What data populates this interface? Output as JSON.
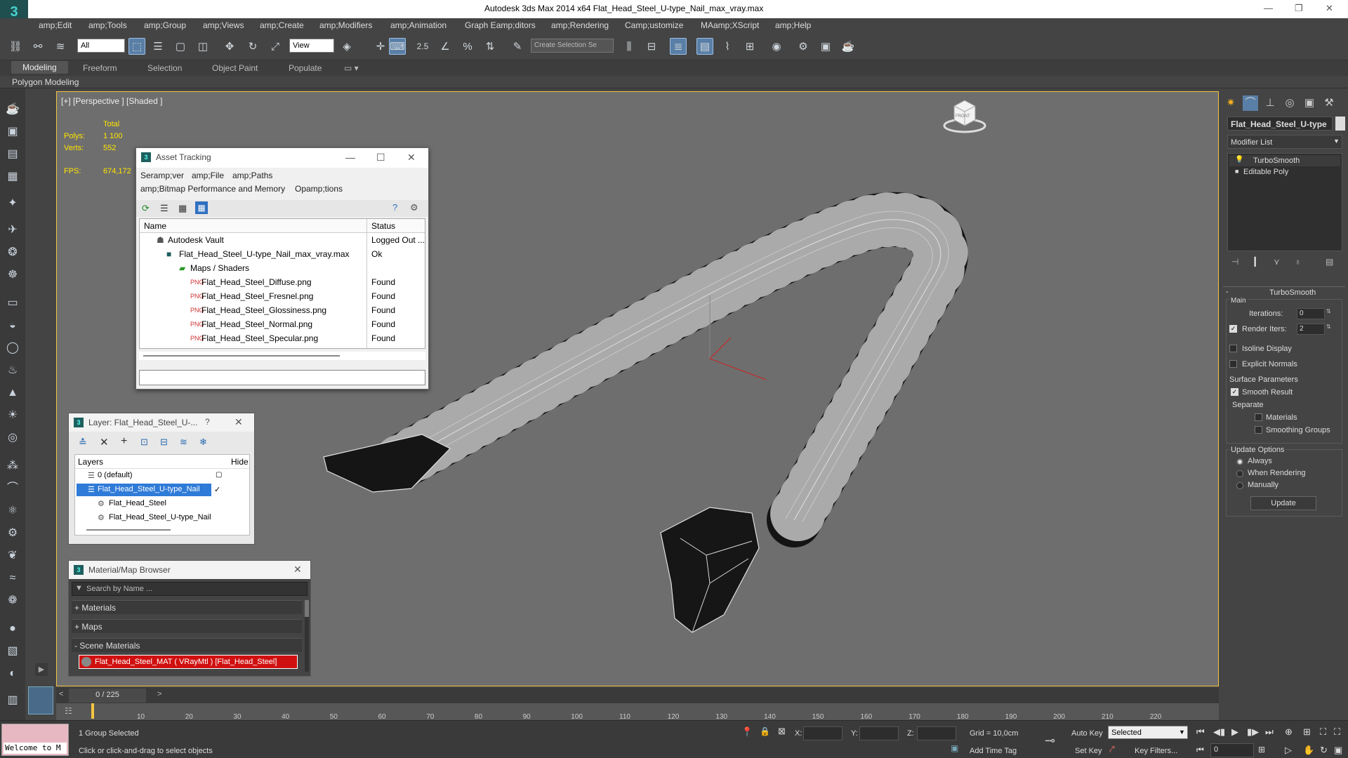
{
  "app": {
    "title": "Autodesk 3ds Max  2014 x64     Flat_Head_Steel_U-type_Nail_max_vray.max",
    "logo_letter": "3",
    "window_controls": [
      "—",
      "❐",
      "✕"
    ]
  },
  "menu": [
    "amp;Edit",
    "amp;Tools",
    "amp;Group",
    "amp;Views",
    "amp;Create",
    "amp;Modifiers",
    "amp;Animation",
    "Graph Eamp;ditors",
    "amp;Rendering",
    "Camp;ustomize",
    "MAamp;XScript",
    "amp;Help"
  ],
  "toolbar": {
    "filter_value": "All",
    "refcoord_value": "View",
    "snap_label": "2.5",
    "selection_set_placeholder": "Create Selection Se"
  },
  "ribbon": {
    "tabs": [
      "Modeling",
      "Freeform",
      "Selection",
      "Object Paint",
      "Populate"
    ],
    "active": "Modeling",
    "subpanel": "Polygon Modeling"
  },
  "viewport": {
    "label": "[+] [Perspective ] [Shaded ]",
    "stats": {
      "total_label": "Total",
      "polys_label": "Polys:",
      "polys_value": "1 100",
      "verts_label": "Verts:",
      "verts_value": "552",
      "fps_label": "FPS:",
      "fps_value": "674,172"
    },
    "viewcube_label": "FRONT"
  },
  "asset_tracking": {
    "title": "Asset Tracking",
    "menu": [
      "Seramp;ver",
      "amp;File",
      "amp;Paths",
      "amp;Bitmap Performance and Memory",
      "Opamp;tions"
    ],
    "columns": [
      "Name",
      "Status"
    ],
    "rows": [
      {
        "name": "Autodesk Vault",
        "status": "Logged Out ..."
      },
      {
        "name": "Flat_Head_Steel_U-type_Nail_max_vray.max",
        "status": "Ok"
      },
      {
        "name": "Maps / Shaders",
        "status": ""
      },
      {
        "name": "Flat_Head_Steel_Diffuse.png",
        "status": "Found"
      },
      {
        "name": "Flat_Head_Steel_Fresnel.png",
        "status": "Found"
      },
      {
        "name": "Flat_Head_Steel_Glossiness.png",
        "status": "Found"
      },
      {
        "name": "Flat_Head_Steel_Normal.png",
        "status": "Found"
      },
      {
        "name": "Flat_Head_Steel_Specular.png",
        "status": "Found"
      }
    ]
  },
  "layer_dialog": {
    "title": "Layer: Flat_Head_Steel_U-...",
    "help": "?",
    "columns": [
      "Layers",
      "Hide"
    ],
    "rows": [
      {
        "name": "0 (default)",
        "selected": false
      },
      {
        "name": "Flat_Head_Steel_U-type_Nail",
        "selected": true
      },
      {
        "name": "Flat_Head_Steel",
        "selected": false
      },
      {
        "name": "Flat_Head_Steel_U-type_Nail",
        "selected": false
      }
    ]
  },
  "material_browser": {
    "title": "Material/Map Browser",
    "search_placeholder": "Search by Name ...",
    "sections": [
      "+ Materials",
      "+ Maps",
      "- Scene Materials"
    ],
    "scene_material": "Flat_Head_Steel_MAT  ( VRayMtl )  [Flat_Head_Steel]"
  },
  "command_panel": {
    "object_name": "Flat_Head_Steel_U-type",
    "modifier_list": "Modifier List",
    "stack": [
      "TurboSmooth",
      "Editable Poly"
    ],
    "rollout_title": "TurboSmooth",
    "main_label": "Main",
    "iterations_label": "Iterations:",
    "iterations_value": "0",
    "render_iters_label": "Render Iters:",
    "render_iters_value": "2",
    "isoline_display": "Isoline Display",
    "explicit_normals": "Explicit Normals",
    "surface_parameters": "Surface Parameters",
    "smooth_result": "Smooth Result",
    "separate": "Separate",
    "materials": "Materials",
    "smoothing_groups": "Smoothing Groups",
    "update_options": "Update Options",
    "always": "Always",
    "when_rendering": "When Rendering",
    "manually": "Manually",
    "update_button": "Update"
  },
  "timeline": {
    "frame": "0 / 225",
    "ticks": [
      "10",
      "20",
      "30",
      "40",
      "50",
      "60",
      "70",
      "80",
      "90",
      "100",
      "110",
      "120",
      "130",
      "140",
      "150",
      "160",
      "170",
      "180",
      "190",
      "200",
      "210",
      "220"
    ]
  },
  "status": {
    "welcome": "Welcome to M",
    "selected": "1 Group Selected",
    "hint": "Click or click-and-drag to select objects",
    "x_label": "X:",
    "y_label": "Y:",
    "z_label": "Z:",
    "grid": "Grid = 10,0cm",
    "add_time_tag": "Add Time Tag",
    "auto_key": "Auto Key",
    "set_key": "Set Key",
    "selected_dropdown": "Selected",
    "key_filters": "Key Filters...",
    "frame_field": "0"
  }
}
